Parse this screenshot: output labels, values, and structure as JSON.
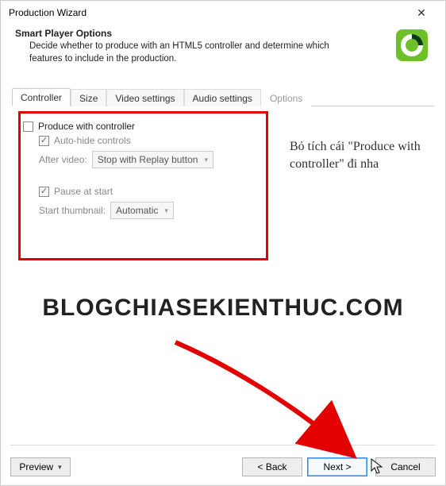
{
  "window": {
    "title": "Production Wizard"
  },
  "header": {
    "title": "Smart Player Options",
    "desc": "Decide whether to produce with an HTML5 controller and determine which features to include in the production."
  },
  "tabs": {
    "controller": "Controller",
    "size": "Size",
    "video": "Video settings",
    "audio": "Audio settings",
    "options": "Options"
  },
  "controller_panel": {
    "produce": "Produce with controller",
    "autohide": "Auto-hide controls",
    "after_video_label": "After video:",
    "after_video_value": "Stop with Replay button",
    "pause": "Pause at start",
    "thumb_label": "Start thumbnail:",
    "thumb_value": "Automatic"
  },
  "annotation": "Bỏ tích cái \"Produce with controller\" đi nha",
  "watermark": "BLOGCHIASEKIENTHUC.COM",
  "footer": {
    "preview": "Preview",
    "back": "< Back",
    "next": "Next >",
    "cancel": "Cancel"
  }
}
